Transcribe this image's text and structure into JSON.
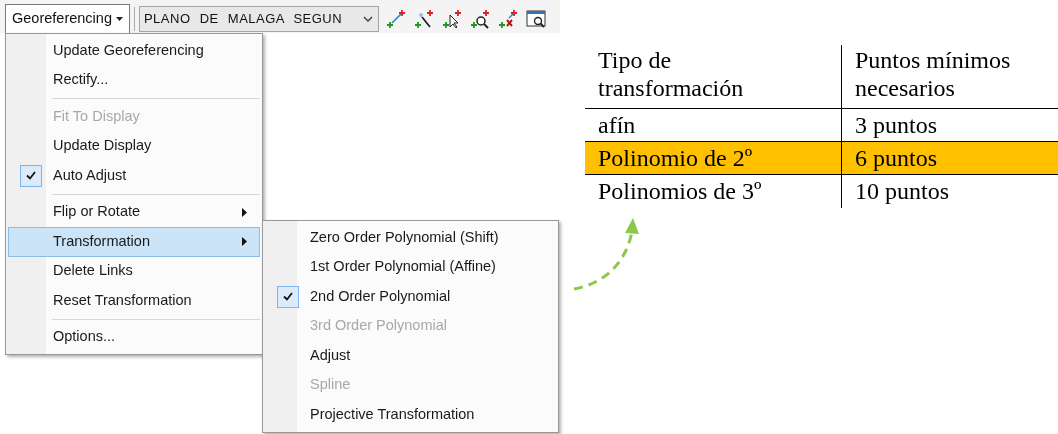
{
  "toolbar": {
    "menu_button": "Georeferencing",
    "layer_select": {
      "value": "PLANO DE MALAGA SEGUN"
    }
  },
  "menu": {
    "items": [
      {
        "kind": "item",
        "label": "Update Georeferencing",
        "checked": false,
        "disabled": false,
        "submenu": false,
        "selected": false
      },
      {
        "kind": "item",
        "label": "Rectify...",
        "checked": false,
        "disabled": false,
        "submenu": false,
        "selected": false
      },
      {
        "kind": "separator"
      },
      {
        "kind": "item",
        "label": "Fit To Display",
        "checked": false,
        "disabled": true,
        "submenu": false,
        "selected": false
      },
      {
        "kind": "item",
        "label": "Update Display",
        "checked": false,
        "disabled": false,
        "submenu": false,
        "selected": false
      },
      {
        "kind": "item",
        "label": "Auto Adjust",
        "checked": true,
        "disabled": false,
        "submenu": false,
        "selected": false
      },
      {
        "kind": "separator"
      },
      {
        "kind": "item",
        "label": "Flip or Rotate",
        "checked": false,
        "disabled": false,
        "submenu": true,
        "selected": false
      },
      {
        "kind": "item",
        "label": "Transformation",
        "checked": false,
        "disabled": false,
        "submenu": true,
        "selected": true
      },
      {
        "kind": "item",
        "label": "Delete Links",
        "checked": false,
        "disabled": false,
        "submenu": false,
        "selected": false
      },
      {
        "kind": "item",
        "label": "Reset Transformation",
        "checked": false,
        "disabled": false,
        "submenu": false,
        "selected": false
      },
      {
        "kind": "separator"
      },
      {
        "kind": "item",
        "label": "Options...",
        "checked": false,
        "disabled": false,
        "submenu": false,
        "selected": false
      }
    ]
  },
  "submenu": {
    "items": [
      {
        "kind": "item",
        "label": "Zero Order Polynomial (Shift)",
        "checked": false,
        "disabled": false
      },
      {
        "kind": "item",
        "label": "1st Order Polynomial (Affine)",
        "checked": false,
        "disabled": false
      },
      {
        "kind": "item",
        "label": "2nd Order Polynomial",
        "checked": true,
        "disabled": false
      },
      {
        "kind": "item",
        "label": "3rd Order Polynomial",
        "checked": false,
        "disabled": true
      },
      {
        "kind": "item",
        "label": "Adjust",
        "checked": false,
        "disabled": false
      },
      {
        "kind": "item",
        "label": "Spline",
        "checked": false,
        "disabled": true
      },
      {
        "kind": "item",
        "label": "Projective Transformation",
        "checked": false,
        "disabled": false
      }
    ]
  },
  "table": {
    "columns": [
      "Tipo de transformación",
      "Puntos mínimos necesarios"
    ],
    "rows": [
      {
        "cells": [
          "afín",
          "3 puntos"
        ],
        "highlighted": false
      },
      {
        "cells": [
          "Polinomio de 2º",
          "6 puntos"
        ],
        "highlighted": true
      },
      {
        "cells": [
          "Polinomios de 3º",
          "10 puntos"
        ],
        "highlighted": false
      }
    ]
  }
}
